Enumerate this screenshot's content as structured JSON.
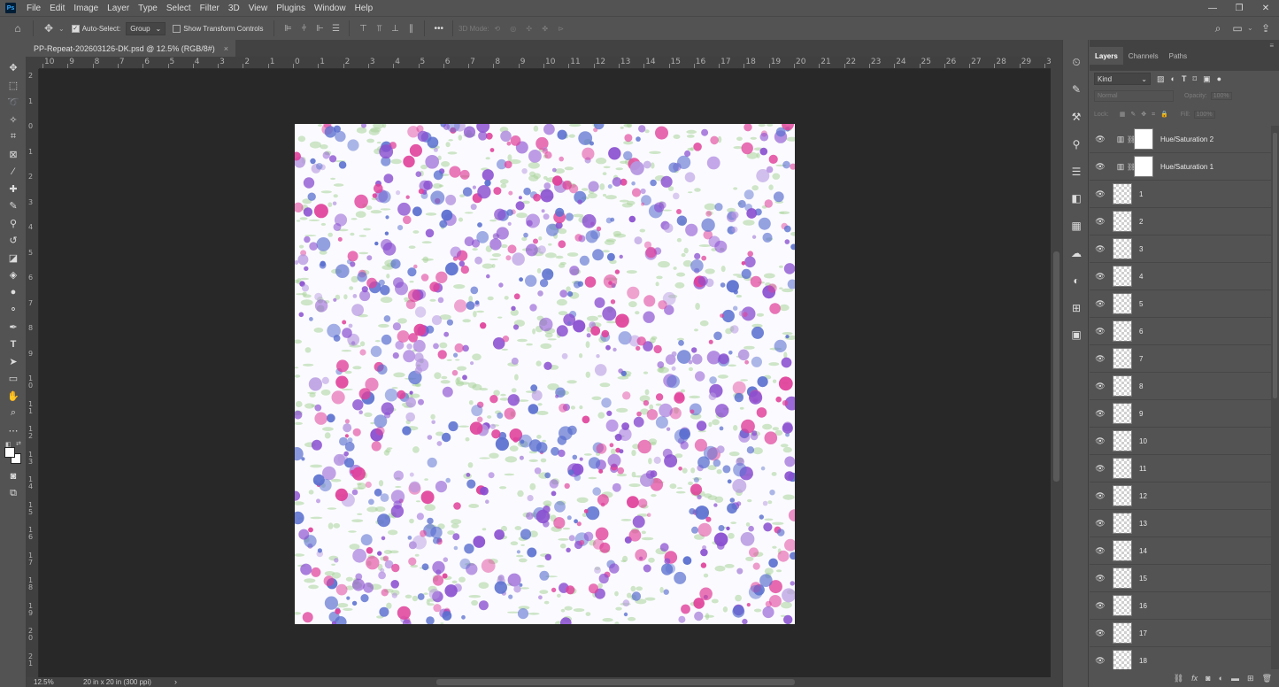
{
  "app": {
    "logo_text": "Ps"
  },
  "menu": [
    "File",
    "Edit",
    "Image",
    "Layer",
    "Type",
    "Select",
    "Filter",
    "3D",
    "View",
    "Plugins",
    "Window",
    "Help"
  ],
  "window_controls": [
    "—",
    "❐",
    "✕"
  ],
  "options_bar": {
    "auto_select_label": "Auto-Select:",
    "auto_select_mode": "Group",
    "show_transform_label": "Show Transform Controls",
    "more_label": "•••",
    "mode_3d_label": "3D Mode:"
  },
  "document": {
    "tab_title": "PP-Repeat-202603126-DK.psd @ 12.5% (RGB/8#)",
    "close_glyph": "×"
  },
  "ruler_h_labels": [
    "10",
    "9",
    "8",
    "7",
    "6",
    "5",
    "4",
    "3",
    "2",
    "1",
    "0",
    "1",
    "2",
    "3",
    "4",
    "5",
    "6",
    "7",
    "8",
    "9",
    "10",
    "11",
    "12",
    "13",
    "14",
    "15",
    "16",
    "17",
    "18",
    "19",
    "20",
    "21",
    "22",
    "23",
    "24",
    "25",
    "26",
    "27",
    "28",
    "29",
    "3"
  ],
  "ruler_v_labels": [
    "2",
    "1",
    "0",
    "1",
    "2",
    "3",
    "4",
    "5",
    "6",
    "7",
    "8",
    "9",
    "1\n0",
    "1\n1",
    "1\n2",
    "1\n3",
    "1\n4",
    "1\n5",
    "1\n6",
    "1\n7",
    "1\n8",
    "1\n9",
    "2\n0",
    "2\n1"
  ],
  "status": {
    "zoom": "12.5%",
    "doc_info": "20 in x 20 in (300 ppi)",
    "arrow": "›"
  },
  "panel": {
    "tabs": [
      "Layers",
      "Channels",
      "Paths"
    ],
    "active_tab": "Layers",
    "filter_kind": "Kind",
    "blend_mode": "Normal",
    "opacity_label": "Opacity:",
    "opacity_value": "100%",
    "lock_label": "Lock:",
    "fill_label": "Fill:",
    "fill_value": "100%"
  },
  "layers": [
    {
      "name": "Hue/Saturation 2",
      "type": "adjustment"
    },
    {
      "name": "Hue/Saturation 1",
      "type": "adjustment"
    },
    {
      "name": "1",
      "type": "pixel"
    },
    {
      "name": "2",
      "type": "pixel"
    },
    {
      "name": "3",
      "type": "pixel"
    },
    {
      "name": "4",
      "type": "pixel"
    },
    {
      "name": "5",
      "type": "pixel"
    },
    {
      "name": "6",
      "type": "pixel"
    },
    {
      "name": "7",
      "type": "pixel"
    },
    {
      "name": "8",
      "type": "pixel"
    },
    {
      "name": "9",
      "type": "pixel"
    },
    {
      "name": "10",
      "type": "pixel"
    },
    {
      "name": "11",
      "type": "pixel"
    },
    {
      "name": "12",
      "type": "pixel"
    },
    {
      "name": "13",
      "type": "pixel"
    },
    {
      "name": "14",
      "type": "pixel"
    },
    {
      "name": "15",
      "type": "pixel"
    },
    {
      "name": "16",
      "type": "pixel"
    },
    {
      "name": "17",
      "type": "pixel"
    },
    {
      "name": "18",
      "type": "pixel"
    }
  ],
  "colors": {
    "ui_bg": "#535353",
    "canvas_bg": "#282828",
    "floral_pink": "#e0409a",
    "floral_purple": "#8a4fd0",
    "floral_blue": "#5a6fcf",
    "floral_lavender": "#b596e0",
    "floral_green": "#a9d49a"
  }
}
